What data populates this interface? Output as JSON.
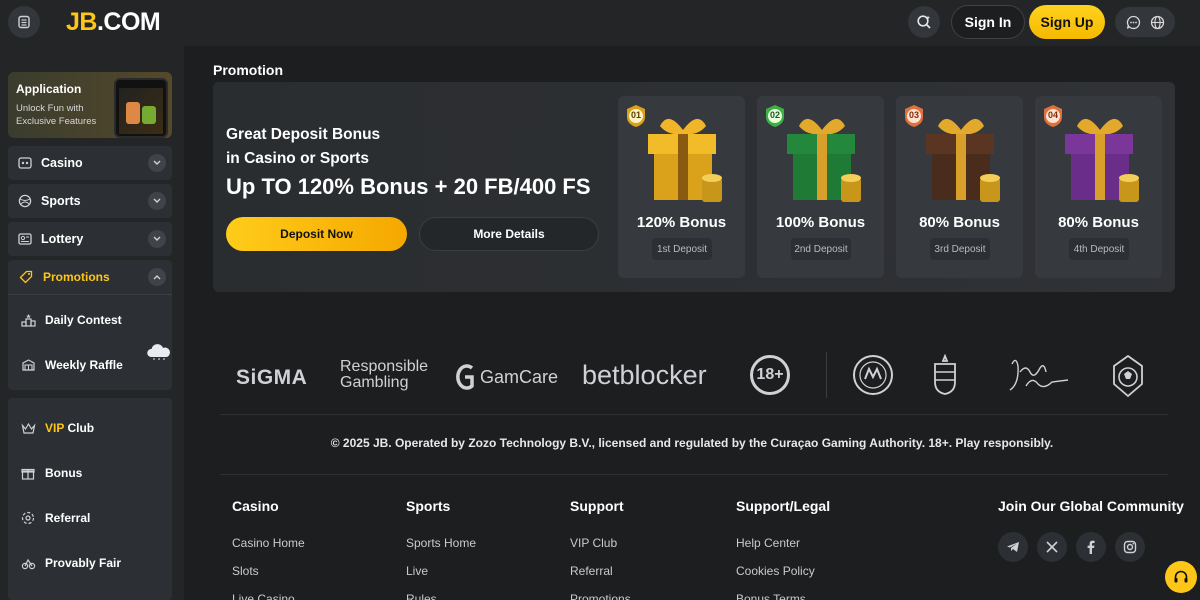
{
  "header": {
    "logo_jb": "JB",
    "logo_com": ".COM",
    "signin_label": "Sign In",
    "signup_label": "Sign Up"
  },
  "sidebar": {
    "app": {
      "title": "Application",
      "subtitle": "Unlock Fun with Exclusive Features"
    },
    "items": [
      {
        "label": "Casino",
        "icon": "casino-icon"
      },
      {
        "label": "Sports",
        "icon": "sports-ball-icon"
      },
      {
        "label": "Lottery",
        "icon": "lottery-icon"
      },
      {
        "label": "Promotions",
        "icon": "tag-icon",
        "active": true
      }
    ],
    "promotions_sub": [
      {
        "label": "Daily Contest",
        "icon": "podium-icon"
      },
      {
        "label": "Weekly Raffle",
        "icon": "raffle-icon"
      }
    ],
    "more": [
      {
        "label_highlight": "VIP",
        "label": " Club",
        "icon": "crown-icon"
      },
      {
        "label": "Bonus",
        "icon": "gift-icon"
      },
      {
        "label": "Referral",
        "icon": "referral-icon"
      },
      {
        "label": "Provably Fair",
        "icon": "fair-icon"
      }
    ]
  },
  "main": {
    "section_title": "Promotion",
    "banner": {
      "line1": "Great Deposit Bonus",
      "line2": "in Casino or Sports",
      "headline": "Up TO 120% Bonus + 20 FB/400 FS",
      "deposit_label": "Deposit Now",
      "details_label": "More Details"
    },
    "bonus_cards": [
      {
        "badge": "01",
        "percent": "120% Bonus",
        "deposit": "1st Deposit",
        "color": "#d9a21a",
        "badge_color": "#d9a21a"
      },
      {
        "badge": "02",
        "percent": "100% Bonus",
        "deposit": "2nd Deposit",
        "color": "#1f7a35",
        "badge_color": "#3cb043"
      },
      {
        "badge": "03",
        "percent": "80% Bonus",
        "deposit": "3rd Deposit",
        "color": "#4a2c1c",
        "badge_color": "#e0713a"
      },
      {
        "badge": "04",
        "percent": "80% Bonus",
        "deposit": "4th Deposit",
        "color": "#6a2d8a",
        "badge_color": "#e0713a"
      }
    ]
  },
  "footer": {
    "partners": {
      "sigma": "SiGMA",
      "responsible_1": "Responsible",
      "responsible_2": "Gambling",
      "gamcare": "GamCare",
      "betblocker": "betblocker",
      "age": "18+"
    },
    "copyright": "© 2025 JB. Operated by Zozo Technology B.V., licensed and regulated by the Curaçao Gaming Authority. 18+. Play responsibly.",
    "columns": [
      {
        "heading": "Casino",
        "links": [
          "Casino Home",
          "Slots",
          "Live Casino"
        ]
      },
      {
        "heading": "Sports",
        "links": [
          "Sports Home",
          "Live",
          "Rules"
        ]
      },
      {
        "heading": "Support",
        "links": [
          "VIP Club",
          "Referral",
          "Promotions"
        ]
      },
      {
        "heading": "Support/Legal",
        "links": [
          "Help Center",
          "Cookies Policy",
          "Bonus Terms"
        ]
      }
    ],
    "community_heading": "Join Our Global Community"
  },
  "colors": {
    "accent": "#ffc61a",
    "bg": "#1c1e20",
    "panel": "#2c2f33"
  }
}
